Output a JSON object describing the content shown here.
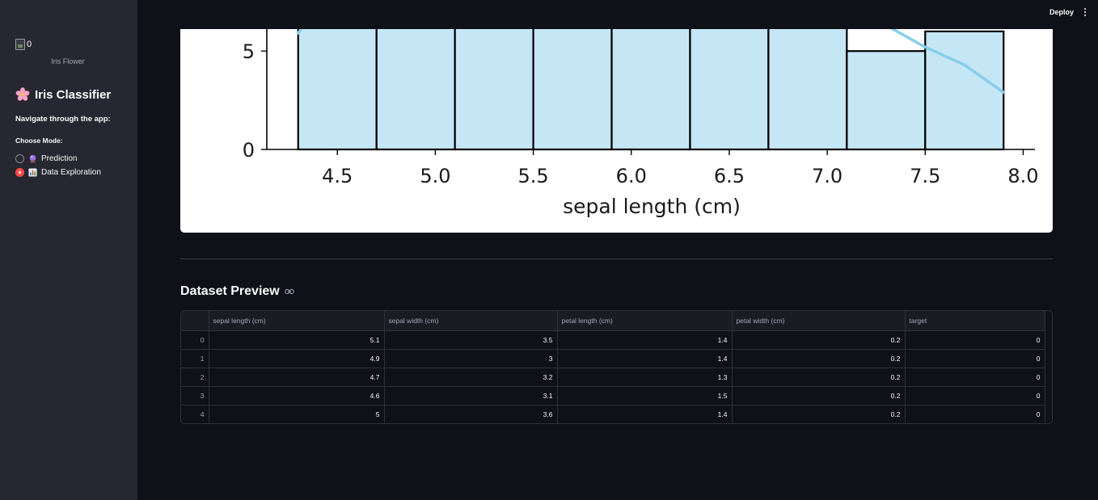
{
  "sidebar": {
    "logo_alt": "0",
    "logo_caption": "Iris Flower",
    "title": "Iris Classifier",
    "title_icon": "cherry-blossom-icon",
    "nav_text": "Navigate through the app:",
    "mode_label": "Choose Mode:",
    "modes": [
      {
        "label": "Prediction",
        "icon": "crystal-ball-icon",
        "selected": false
      },
      {
        "label": "Data Exploration",
        "icon": "bar-chart-icon",
        "selected": true
      }
    ],
    "accent": "#ff4b4b"
  },
  "header": {
    "deploy_label": "Deploy",
    "menu_icon": "kebab-menu-icon"
  },
  "chart_data": {
    "type": "bar",
    "xlabel": "sepal length (cm)",
    "ylabel": "",
    "xlim": [
      4.14,
      8.06
    ],
    "ylim": [
      0,
      6.2
    ],
    "x_ticks": [
      "4.5",
      "5.0",
      "5.5",
      "6.0",
      "6.5",
      "7.0",
      "7.5",
      "8.0"
    ],
    "x_tick_values": [
      4.5,
      5.0,
      5.5,
      6.0,
      6.5,
      7.0,
      7.5,
      8.0
    ],
    "y_ticks": [
      "0",
      "5"
    ],
    "y_tick_values": [
      0,
      5
    ],
    "bins": [
      {
        "x0": 4.3,
        "x1": 4.7,
        "count": null
      },
      {
        "x0": 4.7,
        "x1": 5.1,
        "count": null
      },
      {
        "x0": 5.1,
        "x1": 5.5,
        "count": null
      },
      {
        "x0": 5.5,
        "x1": 5.9,
        "count": null
      },
      {
        "x0": 5.9,
        "x1": 6.3,
        "count": null
      },
      {
        "x0": 6.3,
        "x1": 6.7,
        "count": null
      },
      {
        "x0": 6.7,
        "x1": 7.1,
        "count": null
      },
      {
        "x0": 7.1,
        "x1": 7.5,
        "count": 5
      },
      {
        "x0": 7.5,
        "x1": 7.9,
        "count": 6
      }
    ],
    "kde": [
      [
        4.3,
        5.9
      ],
      [
        4.32,
        6.2
      ],
      [
        7.32,
        6.2
      ],
      [
        7.5,
        5.2
      ],
      [
        7.7,
        4.3
      ],
      [
        7.9,
        2.9
      ]
    ],
    "bar_color": "#c5e6f5",
    "kde_color": "#87ceeb",
    "cropped_top": true
  },
  "section": {
    "title": "Dataset Preview",
    "anchor_icon": "link-icon"
  },
  "table": {
    "columns": [
      "",
      "sepal length (cm)",
      "sepal width (cm)",
      "petal length (cm)",
      "petal width (cm)",
      "target"
    ],
    "rows": [
      [
        "0",
        "5.1",
        "3.5",
        "1.4",
        "0.2",
        "0"
      ],
      [
        "1",
        "4.9",
        "3",
        "1.4",
        "0.2",
        "0"
      ],
      [
        "2",
        "4.7",
        "3.2",
        "1.3",
        "0.2",
        "0"
      ],
      [
        "3",
        "4.6",
        "3.1",
        "1.5",
        "0.2",
        "0"
      ],
      [
        "4",
        "5",
        "3.6",
        "1.4",
        "0.2",
        "0"
      ]
    ]
  }
}
